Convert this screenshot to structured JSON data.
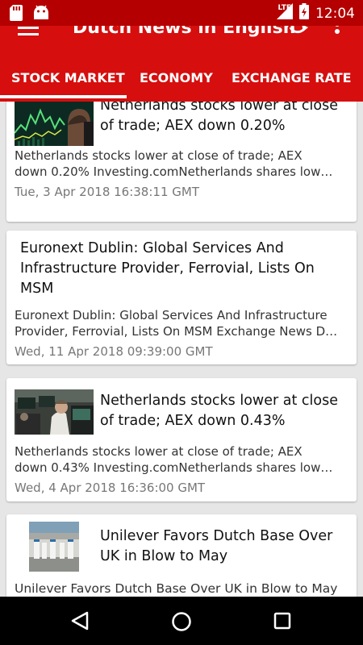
{
  "status_bar": {
    "time": "12:04",
    "network": "LTE"
  },
  "app_bar": {
    "title": "Dutch News in English",
    "icons": [
      "menu-icon",
      "refresh-icon",
      "more-vert-icon"
    ]
  },
  "tabs": [
    {
      "label": "STOCK MARKET",
      "selected": true
    },
    {
      "label": "ECONOMY",
      "selected": false
    },
    {
      "label": "EXCHANGE RATE",
      "selected": false
    }
  ],
  "articles": [
    {
      "headline": "Netherlands stocks lower at close of trade; AEX down 0.20%",
      "summary_line1": "Netherlands stocks lower at close of trade; AEX",
      "summary_line2": "down 0.20%  Investing.comNetherlands shares low…",
      "date": "Tue, 3 Apr 2018 16:38:11 GMT",
      "has_image": true
    },
    {
      "headline": "Euronext Dublin: Global Services And Infrastructure Provider, Ferrovial, Lists On MSM",
      "summary_line1": "Euronext Dublin: Global Services And Infrastructure",
      "summary_line2": "Provider, Ferrovial, Lists On MSM  Exchange News D…",
      "date": "Wed, 11 Apr 2018 09:39:00 GMT",
      "has_image": false
    },
    {
      "headline": "Netherlands stocks lower at close of trade; AEX down 0.43%",
      "summary_line1": "Netherlands stocks lower at close of trade; AEX",
      "summary_line2": "down 0.43%  Investing.comNetherlands shares low…",
      "date": "Wed, 4 Apr 2018 16:36:00 GMT",
      "has_image": true
    },
    {
      "headline": "Unilever Favors Dutch Base Over UK in Blow to May",
      "summary_line1": "Unilever Favors Dutch Base Over UK in Blow to May",
      "has_image": true
    }
  ],
  "colors": {
    "status_bar": "#b40000",
    "app_bar": "#d60e0e",
    "background": "#e6e6e6"
  }
}
